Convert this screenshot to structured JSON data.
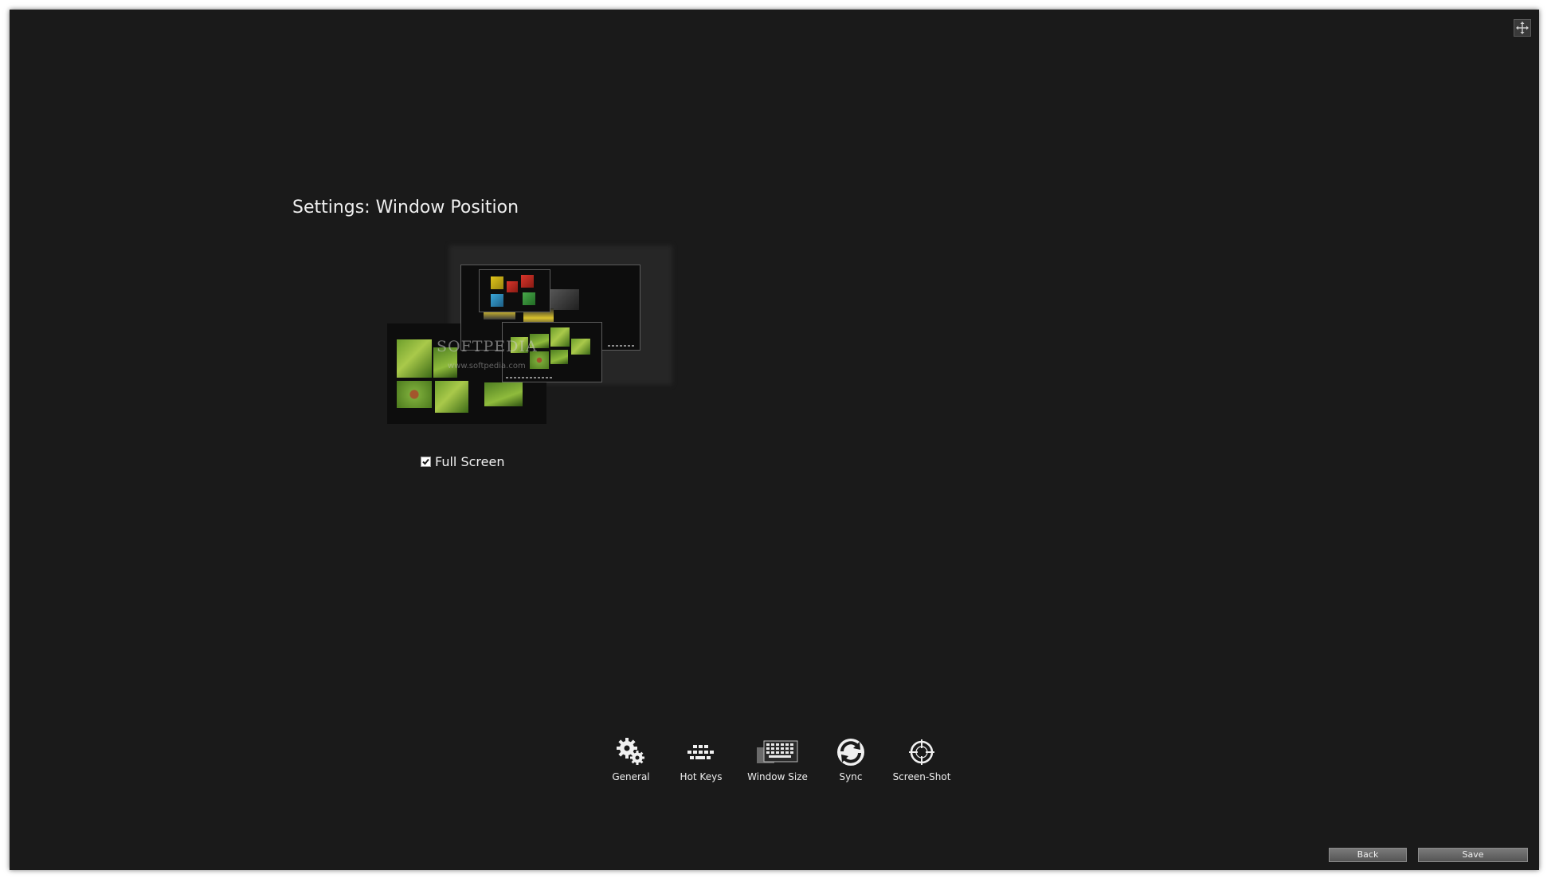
{
  "page": {
    "title": "Settings: Window Position"
  },
  "preview": {
    "watermark_title": "SOFTPEDIA",
    "watermark_url": "www.softpedia.com"
  },
  "fullscreen": {
    "label": "Full Screen",
    "checked": true
  },
  "nav": {
    "items": [
      {
        "label": "General",
        "icon": "gears-icon"
      },
      {
        "label": "Hot Keys",
        "icon": "keys-icon"
      },
      {
        "label": "Window Size",
        "icon": "keyboard-icon"
      },
      {
        "label": "Sync",
        "icon": "sync-icon"
      },
      {
        "label": "Screen-Shot",
        "icon": "crosshair-icon"
      }
    ]
  },
  "buttons": {
    "back": "Back",
    "save": "Save"
  },
  "colors": {
    "background": "#1a1a1a",
    "text": "#eeeeee",
    "button": "#666666"
  }
}
